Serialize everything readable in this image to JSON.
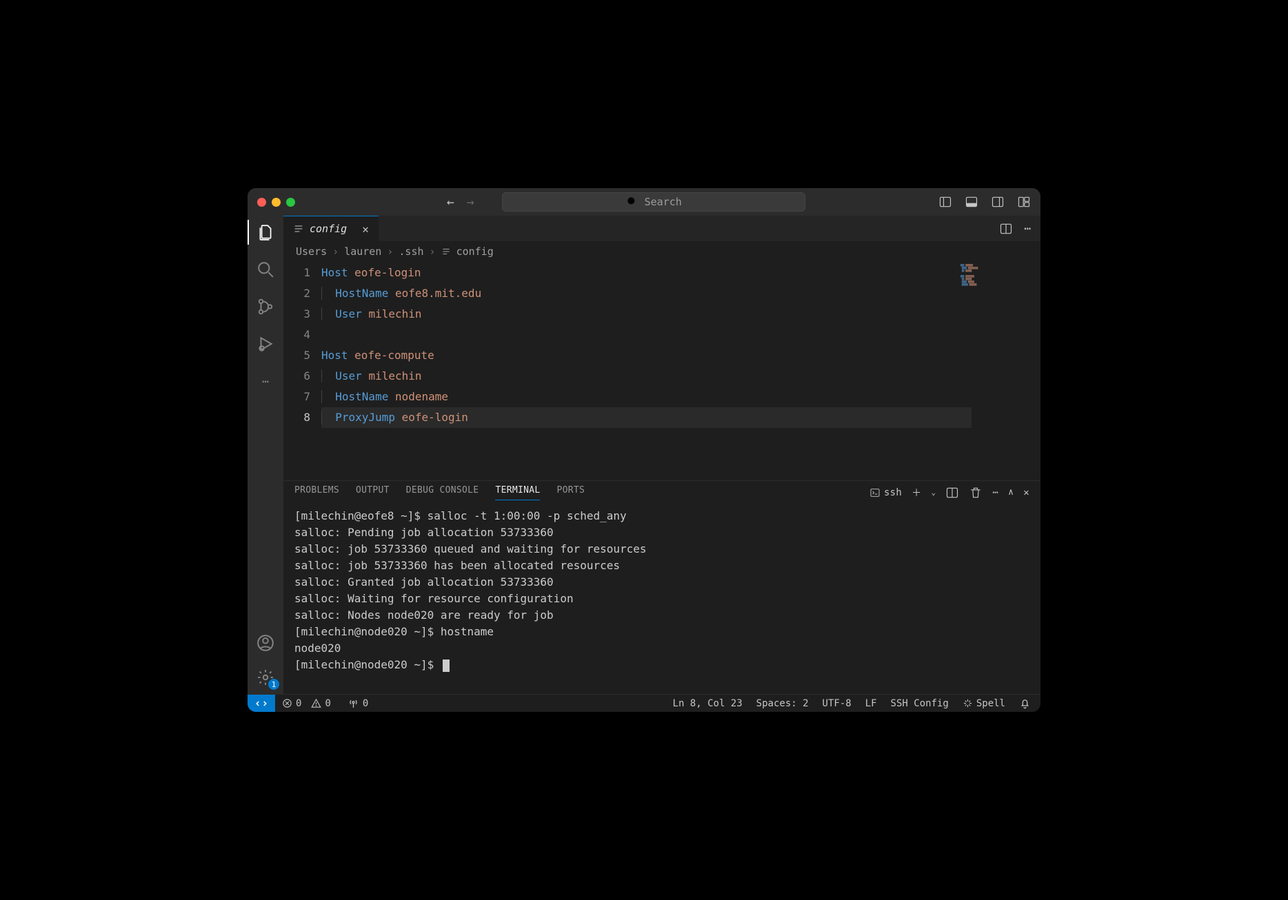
{
  "titlebar": {
    "search_placeholder": "Search"
  },
  "activitybar": {
    "badge_settings": "1"
  },
  "tab": {
    "label": "config"
  },
  "breadcrumb": {
    "parts": [
      "Users",
      "lauren",
      ".ssh",
      "config"
    ]
  },
  "editor": {
    "lines": [
      {
        "n": "1",
        "tokens": [
          {
            "t": "Host ",
            "c": "kw"
          },
          {
            "t": "eofe-login",
            "c": "val"
          }
        ]
      },
      {
        "n": "2",
        "indent": true,
        "tokens": [
          {
            "t": "HostName ",
            "c": "kw"
          },
          {
            "t": "eofe8.mit.edu",
            "c": "val"
          }
        ]
      },
      {
        "n": "3",
        "indent": true,
        "tokens": [
          {
            "t": "User ",
            "c": "kw"
          },
          {
            "t": "milechin",
            "c": "val"
          }
        ]
      },
      {
        "n": "4",
        "tokens": []
      },
      {
        "n": "5",
        "tokens": [
          {
            "t": "Host ",
            "c": "kw"
          },
          {
            "t": "eofe-compute",
            "c": "val"
          }
        ]
      },
      {
        "n": "6",
        "indent": true,
        "tokens": [
          {
            "t": "User ",
            "c": "kw"
          },
          {
            "t": "milechin",
            "c": "val"
          }
        ]
      },
      {
        "n": "7",
        "indent": true,
        "tokens": [
          {
            "t": "HostName ",
            "c": "kw"
          },
          {
            "t": "nodename",
            "c": "val"
          }
        ]
      },
      {
        "n": "8",
        "indent": true,
        "current": true,
        "tokens": [
          {
            "t": "ProxyJump ",
            "c": "kw"
          },
          {
            "t": "eofe-login",
            "c": "val"
          }
        ]
      }
    ]
  },
  "panel": {
    "tabs": {
      "problems": "PROBLEMS",
      "output": "OUTPUT",
      "debug": "DEBUG CONSOLE",
      "terminal": "TERMINAL",
      "ports": "PORTS"
    },
    "terminal_kind": "ssh",
    "terminal_output": "[milechin@eofe8 ~]$ salloc -t 1:00:00 -p sched_any\nsalloc: Pending job allocation 53733360\nsalloc: job 53733360 queued and waiting for resources\nsalloc: job 53733360 has been allocated resources\nsalloc: Granted job allocation 53733360\nsalloc: Waiting for resource configuration\nsalloc: Nodes node020 are ready for job\n[milechin@node020 ~]$ hostname\nnode020\n[milechin@node020 ~]$ "
  },
  "status": {
    "errors": "0",
    "warnings": "0",
    "ports": "0",
    "cursor": "Ln 8, Col 23",
    "indent": "Spaces: 2",
    "encoding": "UTF-8",
    "eol": "LF",
    "language": "SSH Config",
    "spell": "Spell"
  }
}
